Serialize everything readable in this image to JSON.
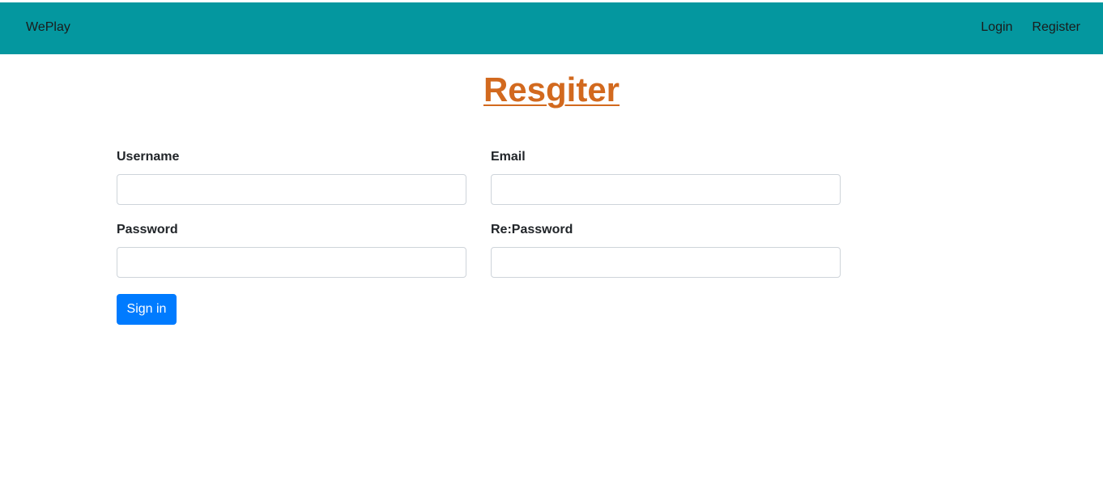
{
  "navbar": {
    "brand": "WePlay",
    "links": [
      {
        "label": "Login"
      },
      {
        "label": "Register"
      }
    ]
  },
  "page": {
    "title": "Resgiter"
  },
  "form": {
    "username_label": "Username",
    "username_value": "",
    "email_label": "Email",
    "email_value": "",
    "password_label": "Password",
    "password_value": "",
    "repassword_label": "Re:Password",
    "repassword_value": "",
    "submit_label": "Sign in"
  },
  "colors": {
    "navbar_bg": "#04979f",
    "title_link": "#d2691e",
    "primary_button": "#007bff"
  }
}
